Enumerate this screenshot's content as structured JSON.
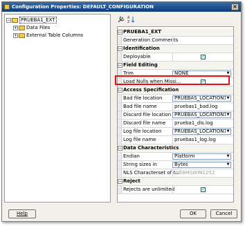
{
  "window": {
    "title": "Configuration Properties: DEFAULT_CONFIGURATION",
    "close_glyph": "×"
  },
  "tree": {
    "root": {
      "label": "PRUEBA1_EXT",
      "expander": "−"
    },
    "children": [
      {
        "label": "Data Files",
        "expander": "+"
      },
      {
        "label": "External Table Columns",
        "expander": "+"
      }
    ]
  },
  "toolbar": {
    "icons": [
      "wrench-icon",
      "sort-icon"
    ]
  },
  "properties": {
    "rows": [
      {
        "type": "group",
        "expander": "−",
        "name": "PRUEBA1_EXT"
      },
      {
        "type": "text",
        "name": "Generation Comments",
        "value": ""
      },
      {
        "type": "group",
        "expander": "−",
        "name": "Identification"
      },
      {
        "type": "check",
        "name": "Deployable",
        "checked": "✓"
      },
      {
        "type": "group",
        "expander": "−",
        "name": "Field Editing"
      },
      {
        "type": "dropdown",
        "name": "Trim",
        "value": "NONE"
      },
      {
        "type": "check",
        "name": "Load Nulls when Missi...",
        "checked": "✓"
      },
      {
        "type": "group",
        "expander": "−",
        "name": "Access Specification"
      },
      {
        "type": "dropdown",
        "name": "Bad file location",
        "value": "PRUEBAS_LOCATION1"
      },
      {
        "type": "text",
        "name": "Bad file name",
        "value": "pruebas1_bad.log"
      },
      {
        "type": "dropdown",
        "name": "Discard file location",
        "value": "PRUEBAS_LOCATION1"
      },
      {
        "type": "text",
        "name": "Discard file name",
        "value": "prueba1_dis.log"
      },
      {
        "type": "dropdown",
        "name": "Log file location",
        "value": "PRUEBAS_LOCATION1"
      },
      {
        "type": "text",
        "name": "Log file name",
        "value": "pruebas1_log.log"
      },
      {
        "type": "group",
        "expander": "−",
        "name": "Data Characteristics"
      },
      {
        "type": "dropdown",
        "name": "Endian",
        "value": "Platform"
      },
      {
        "type": "dropdown",
        "name": "String sizes in",
        "value": "Bytes"
      },
      {
        "type": "disabled",
        "name": "NLS Characterset of I...",
        "value": "WE8MSWIN1252"
      },
      {
        "type": "group",
        "expander": "−",
        "name": "Reject"
      },
      {
        "type": "check",
        "name": "Rejects are unlimited",
        "checked": "✓"
      }
    ]
  },
  "buttons": {
    "help": "Help",
    "ok": "OK",
    "cancel": "Cancel"
  },
  "colors": {
    "title_bar": "#0d3a7a",
    "highlight": "#e01010",
    "check": "#21a121"
  }
}
